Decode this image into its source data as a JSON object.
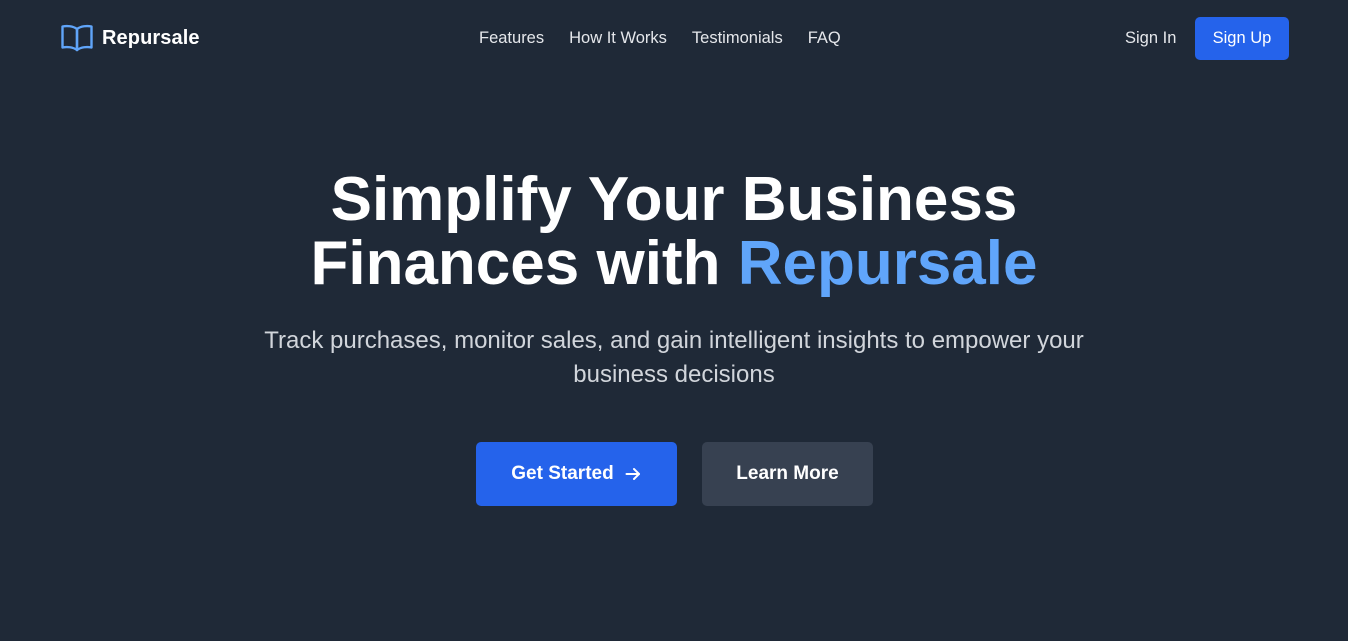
{
  "brand": {
    "name": "Repursale",
    "icon": "book-open-icon",
    "icon_color": "#60a5fa"
  },
  "nav": {
    "items": [
      "Features",
      "How It Works",
      "Testimonials",
      "FAQ"
    ],
    "sign_in": "Sign In",
    "sign_up": "Sign Up"
  },
  "hero": {
    "title_line1": "Simplify Your Business",
    "title_line2_prefix": "Finances with ",
    "title_accent": "Repursale",
    "subtitle": "Track purchases, monitor sales, and gain intelligent insights to empower your business decisions",
    "primary_cta": "Get Started",
    "primary_cta_icon": "arrow-right-icon",
    "secondary_cta": "Learn More"
  },
  "colors": {
    "background": "#1f2937",
    "accent": "#60a5fa",
    "primary_button": "#2563eb",
    "secondary_button": "#374151"
  }
}
